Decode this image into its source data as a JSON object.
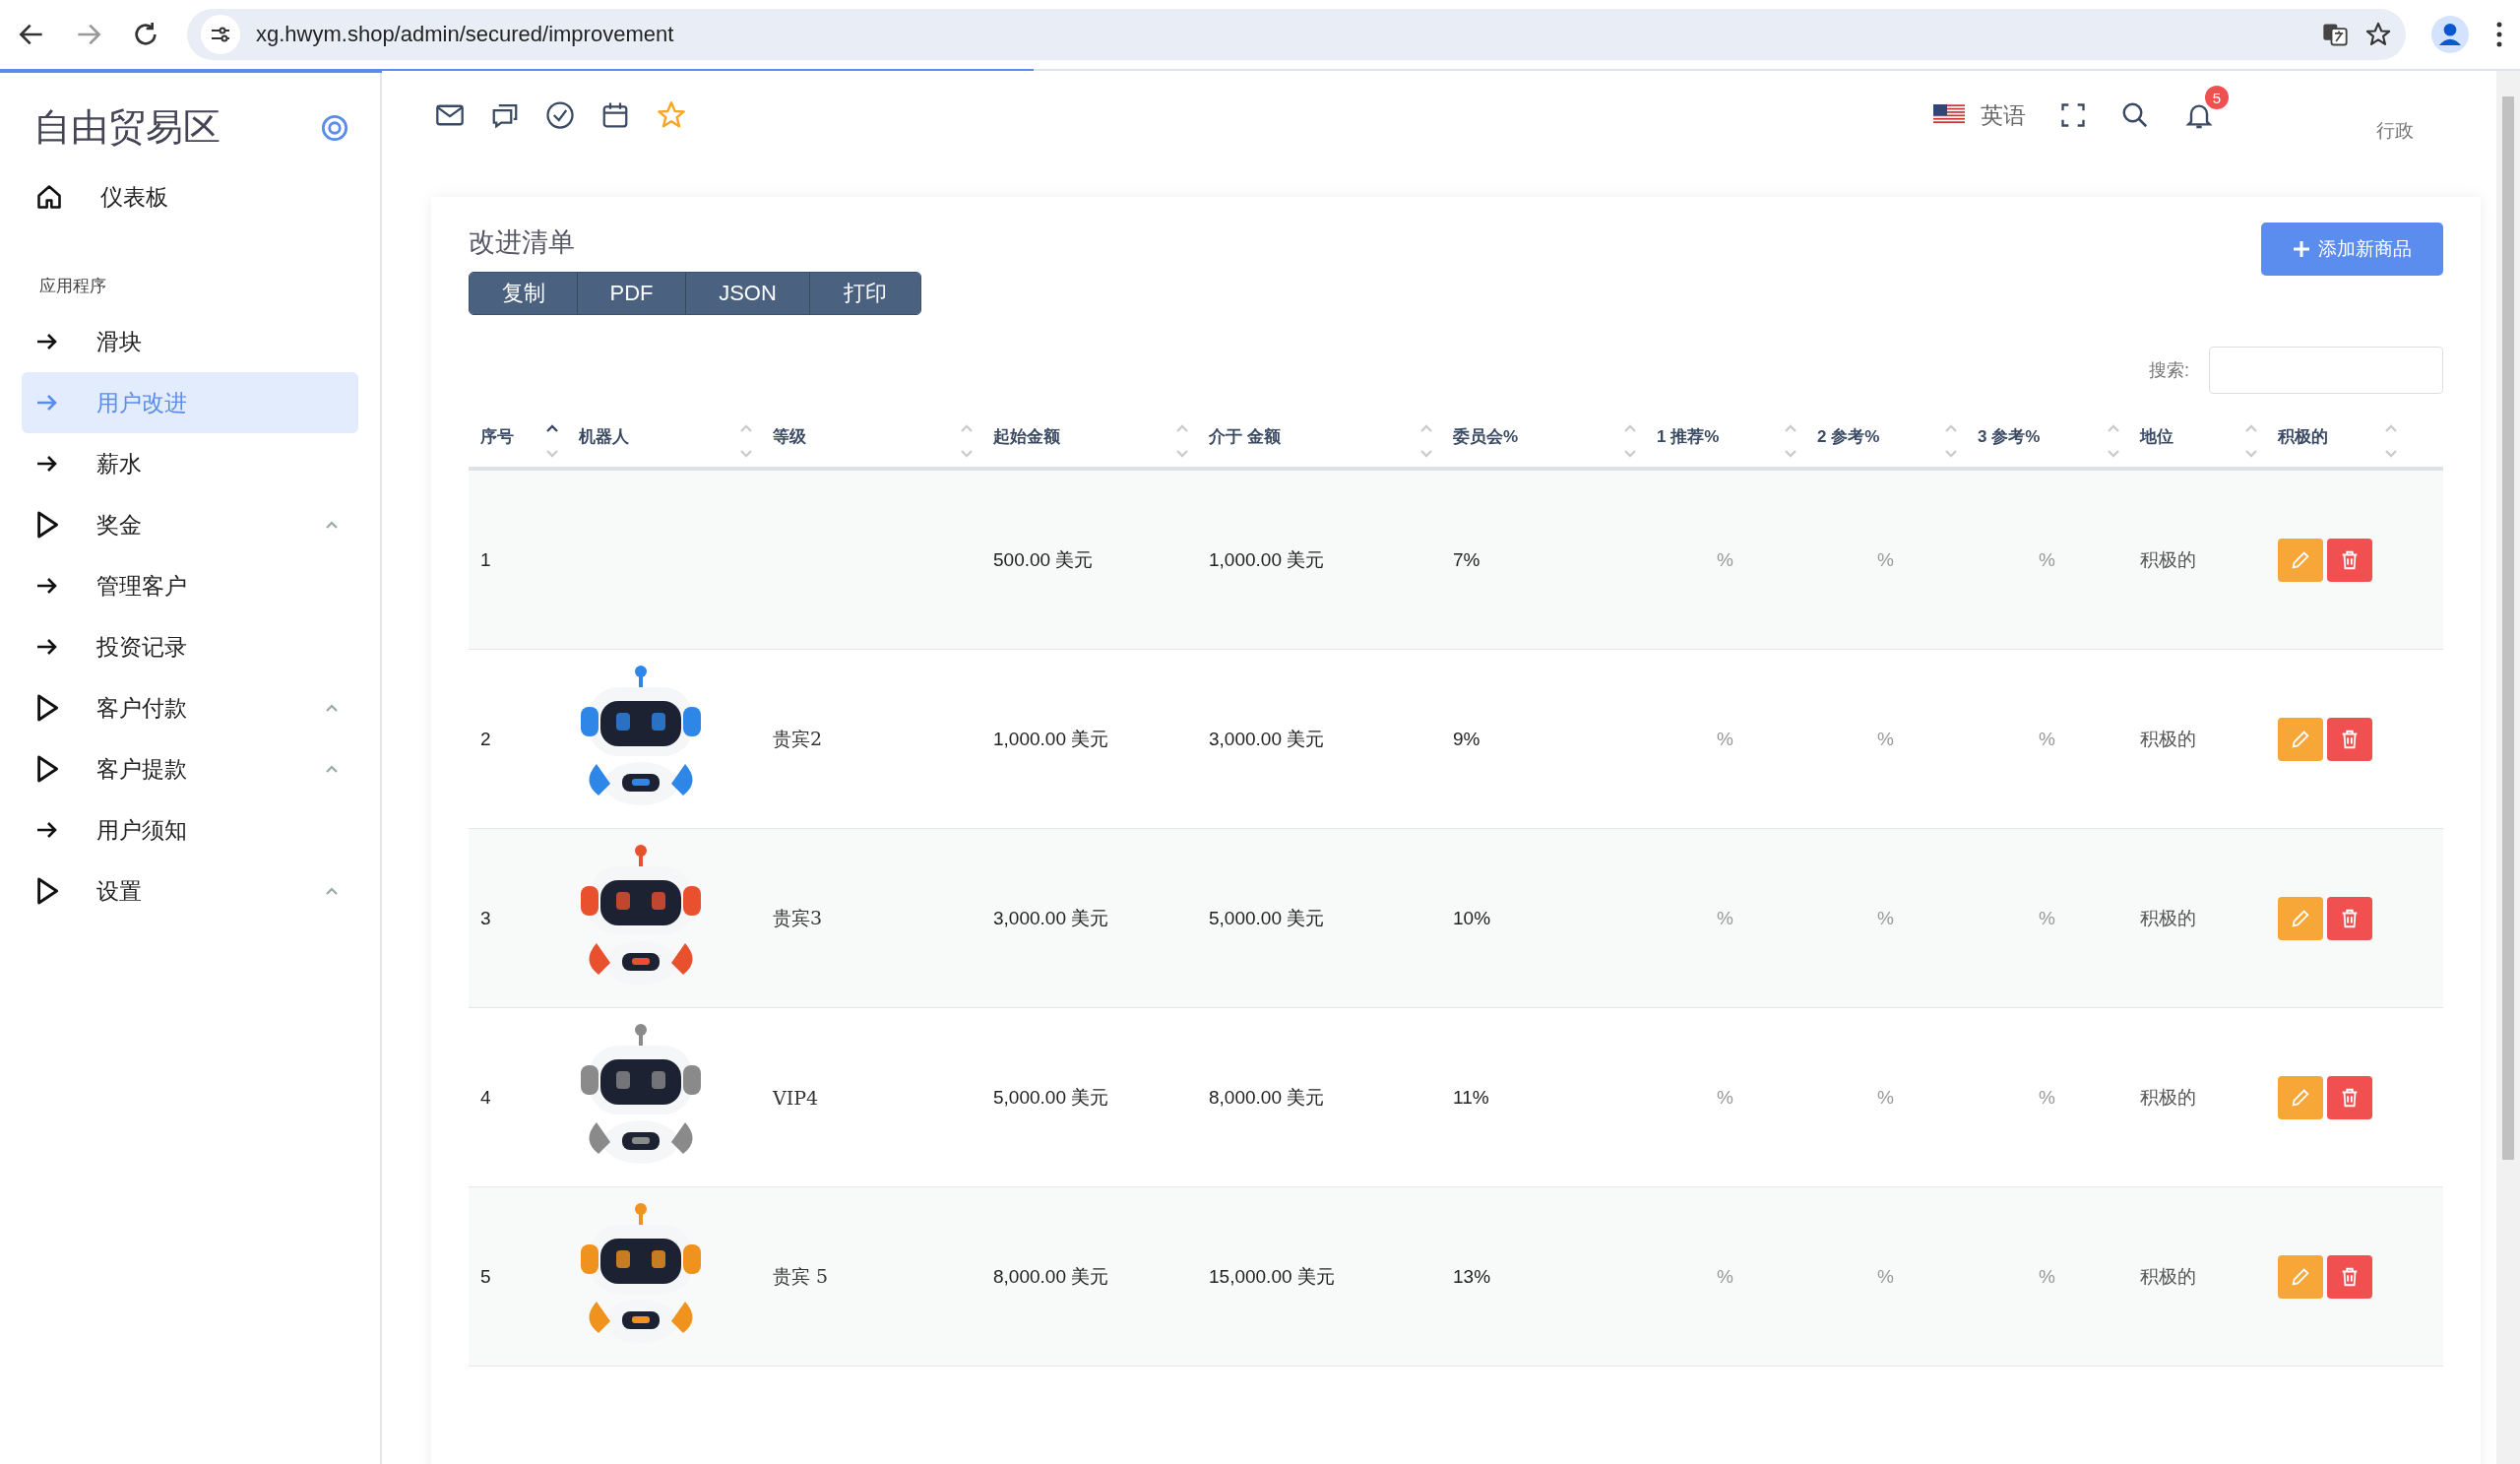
{
  "browser": {
    "url": "xg.hwym.shop/admin/secured/improvement",
    "loading_bar": {
      "level": 0.41
    }
  },
  "sidebar": {
    "brand": "自由贸易区",
    "items": [
      {
        "kind": "home",
        "label": "仪表板",
        "selected": false
      },
      {
        "kind": "section",
        "label": "应用程序"
      },
      {
        "kind": "link",
        "label": "滑块",
        "selected": false
      },
      {
        "kind": "link",
        "label": "用户改进",
        "selected": true
      },
      {
        "kind": "link",
        "label": "薪水",
        "selected": false
      },
      {
        "kind": "group",
        "label": "奖金",
        "selected": false
      },
      {
        "kind": "link",
        "label": "管理客户",
        "selected": false
      },
      {
        "kind": "link",
        "label": "投资记录",
        "selected": false
      },
      {
        "kind": "group",
        "label": "客户付款",
        "selected": false
      },
      {
        "kind": "group",
        "label": "客户提款",
        "selected": false
      },
      {
        "kind": "link",
        "label": "用户须知",
        "selected": false
      },
      {
        "kind": "group",
        "label": "设置",
        "selected": false
      }
    ]
  },
  "topbar": {
    "language": "英语",
    "notifications": "5",
    "user": "行政"
  },
  "card": {
    "title": "改进清单",
    "export_buttons": [
      "复制",
      "PDF",
      "JSON",
      "打印"
    ],
    "add_button": "添加新商品",
    "search_label": "搜索:",
    "table": {
      "columns": [
        {
          "label": "序号",
          "sorted": true
        },
        {
          "label": "机器人",
          "sorted": false
        },
        {
          "label": "等级",
          "sorted": false
        },
        {
          "label": "起始金额",
          "sorted": false
        },
        {
          "label": "介于 金额",
          "sorted": false
        },
        {
          "label": "委员会%",
          "sorted": false
        },
        {
          "label": "1 推荐%",
          "sorted": false
        },
        {
          "label": "2 参考%",
          "sorted": false
        },
        {
          "label": "3 参考%",
          "sorted": false
        },
        {
          "label": "地位",
          "sorted": false
        },
        {
          "label": "积极的",
          "sorted": false
        }
      ],
      "rows": [
        {
          "no": "1",
          "level": "",
          "start": "500.00 美元",
          "between": "1,000.00 美元",
          "commission": "7%",
          "ref1": "%",
          "ref2": "%",
          "ref3": "%",
          "status": "积极的"
        },
        {
          "no": "2",
          "level": "贵宾2",
          "start": "1,000.00 美元",
          "between": "3,000.00 美元",
          "commission": "9%",
          "ref1": "%",
          "ref2": "%",
          "ref3": "%",
          "status": "积极的"
        },
        {
          "no": "3",
          "level": "贵宾3",
          "start": "3,000.00 美元",
          "between": "5,000.00 美元",
          "commission": "10%",
          "ref1": "%",
          "ref2": "%",
          "ref3": "%",
          "status": "积极的"
        },
        {
          "no": "4",
          "level": "VIP4",
          "start": "5,000.00 美元",
          "between": "8,000.00 美元",
          "commission": "11%",
          "ref1": "%",
          "ref2": "%",
          "ref3": "%",
          "status": "积极的"
        },
        {
          "no": "5",
          "level": "贵宾 5",
          "start": "8,000.00 美元",
          "between": "15,000.00 美元",
          "commission": "13%",
          "ref1": "%",
          "ref2": "%",
          "ref3": "%",
          "status": "积极的"
        }
      ]
    }
  }
}
